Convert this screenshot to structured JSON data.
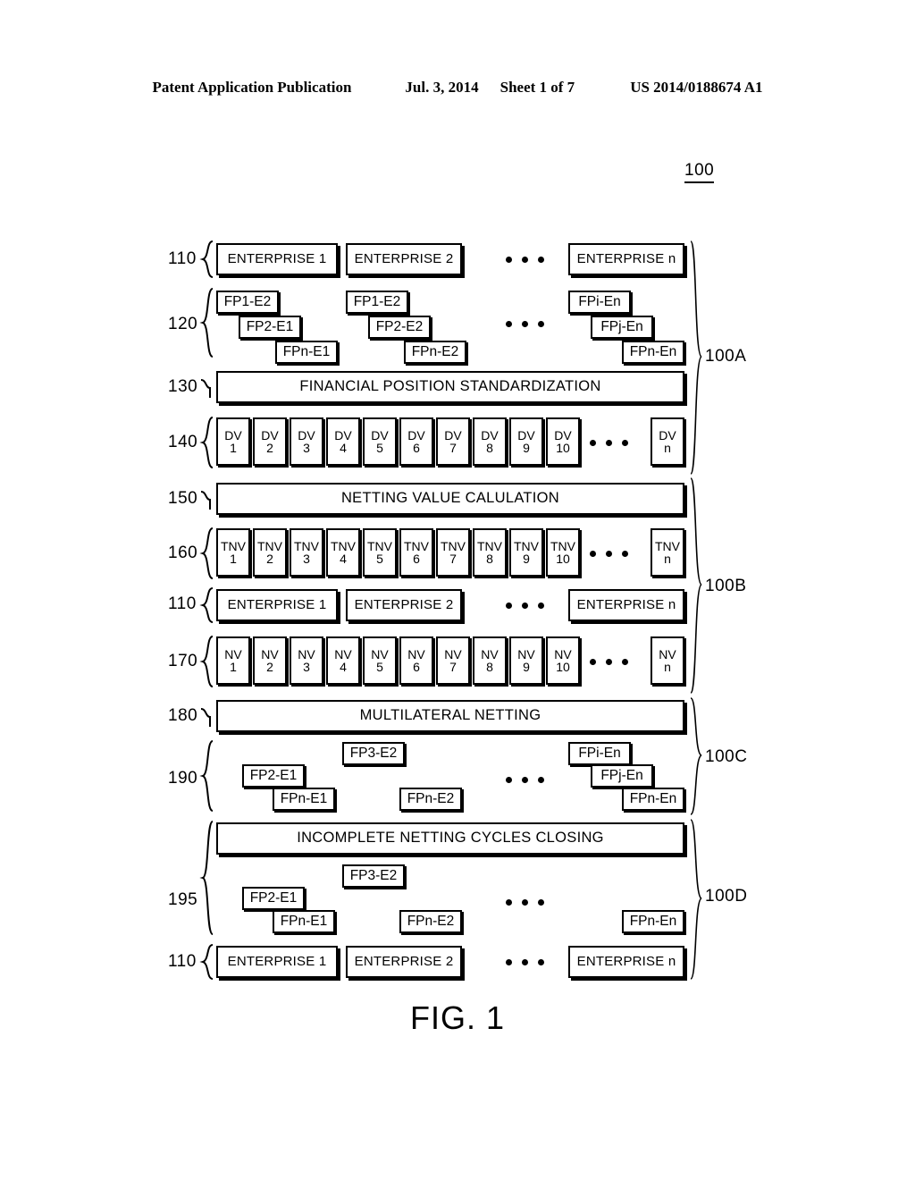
{
  "header": {
    "publication": "Patent Application Publication",
    "date": "Jul. 3, 2014",
    "sheet": "Sheet 1 of 7",
    "patent_number": "US 2014/0188674 A1"
  },
  "figure": {
    "caption": "FIG. 1",
    "system_ref": "100"
  },
  "callouts": {
    "c110a": "110",
    "c120": "120",
    "c130": "130",
    "c140": "140",
    "c150": "150",
    "c160": "160",
    "c110b": "110",
    "c170": "170",
    "c180": "180",
    "c190": "190",
    "c195": "195",
    "c110c": "110",
    "g100A": "100A",
    "g100B": "100B",
    "g100C": "100C",
    "g100D": "100D"
  },
  "rows": {
    "enterprises_top": [
      "ENTERPRISE 1",
      "ENTERPRISE 2",
      "ENTERPRISE n"
    ],
    "enterprises_mid": [
      "ENTERPRISE 1",
      "ENTERPRISE 2",
      "ENTERPRISE n"
    ],
    "enterprises_bottom": [
      "ENTERPRISE 1",
      "ENTERPRISE 2",
      "ENTERPRISE n"
    ],
    "fp_stacks_120": {
      "group1": [
        "FP1-E2",
        "FP2-E1",
        "FPn-E1"
      ],
      "group2": [
        "FP1-E2",
        "FP2-E2",
        "FPn-E2"
      ],
      "group3": [
        "FPi-En",
        "FPj-En",
        "FPn-En"
      ]
    },
    "fp_row_190": {
      "fp3e2": "FP3-E2",
      "fp2e1": "FP2-E1",
      "fpne1": "FPn-E1",
      "fpne2": "FPn-E2",
      "group3": [
        "FPi-En",
        "FPj-En",
        "FPn-En"
      ]
    },
    "fp_row_195": {
      "fp3e2": "FP3-E2",
      "fp2e1": "FP2-E1",
      "fpne1": "FPn-E1",
      "fpne2": "FPn-E2",
      "fpnen": "FPn-En"
    },
    "dv": [
      {
        "t": "DV",
        "b": "1"
      },
      {
        "t": "DV",
        "b": "2"
      },
      {
        "t": "DV",
        "b": "3"
      },
      {
        "t": "DV",
        "b": "4"
      },
      {
        "t": "DV",
        "b": "5"
      },
      {
        "t": "DV",
        "b": "6"
      },
      {
        "t": "DV",
        "b": "7"
      },
      {
        "t": "DV",
        "b": "8"
      },
      {
        "t": "DV",
        "b": "9"
      },
      {
        "t": "DV",
        "b": "10"
      },
      {
        "t": "DV",
        "b": "n"
      }
    ],
    "tnv": [
      {
        "t": "TNV",
        "b": "1"
      },
      {
        "t": "TNV",
        "b": "2"
      },
      {
        "t": "TNV",
        "b": "3"
      },
      {
        "t": "TNV",
        "b": "4"
      },
      {
        "t": "TNV",
        "b": "5"
      },
      {
        "t": "TNV",
        "b": "6"
      },
      {
        "t": "TNV",
        "b": "7"
      },
      {
        "t": "TNV",
        "b": "8"
      },
      {
        "t": "TNV",
        "b": "9"
      },
      {
        "t": "TNV",
        "b": "10"
      },
      {
        "t": "TNV",
        "b": "n"
      }
    ],
    "nv": [
      {
        "t": "NV",
        "b": "1"
      },
      {
        "t": "NV",
        "b": "2"
      },
      {
        "t": "NV",
        "b": "3"
      },
      {
        "t": "NV",
        "b": "4"
      },
      {
        "t": "NV",
        "b": "5"
      },
      {
        "t": "NV",
        "b": "6"
      },
      {
        "t": "NV",
        "b": "7"
      },
      {
        "t": "NV",
        "b": "8"
      },
      {
        "t": "NV",
        "b": "9"
      },
      {
        "t": "NV",
        "b": "10"
      },
      {
        "t": "NV",
        "b": "n"
      }
    ]
  },
  "processes": {
    "p130": "FINANCIAL POSITION STANDARDIZATION",
    "p150": "NETTING VALUE CALULATION",
    "p180": "MULTILATERAL NETTING",
    "p195": "INCOMPLETE NETTING CYCLES CLOSING"
  },
  "colors": {
    "ink": "#000000",
    "paper": "#ffffff"
  }
}
